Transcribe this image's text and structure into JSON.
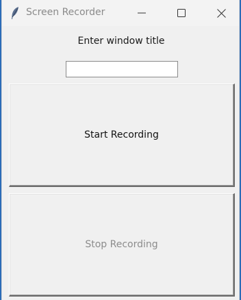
{
  "window": {
    "title": "Screen Recorder",
    "app_icon": "feather-icon",
    "controls": {
      "minimize_icon": "minimize-icon",
      "maximize_icon": "maximize-icon",
      "close_icon": "close-icon"
    }
  },
  "form": {
    "prompt_label": "Enter window title",
    "title_input_value": "",
    "title_input_placeholder": ""
  },
  "buttons": {
    "start_label": "Start Recording",
    "start_enabled": true,
    "stop_label": "Stop Recording",
    "stop_enabled": false
  },
  "colors": {
    "desktop": "#2b6cb8",
    "window_bg": "#f0f0f0",
    "disabled_text": "#8c8c8c"
  }
}
